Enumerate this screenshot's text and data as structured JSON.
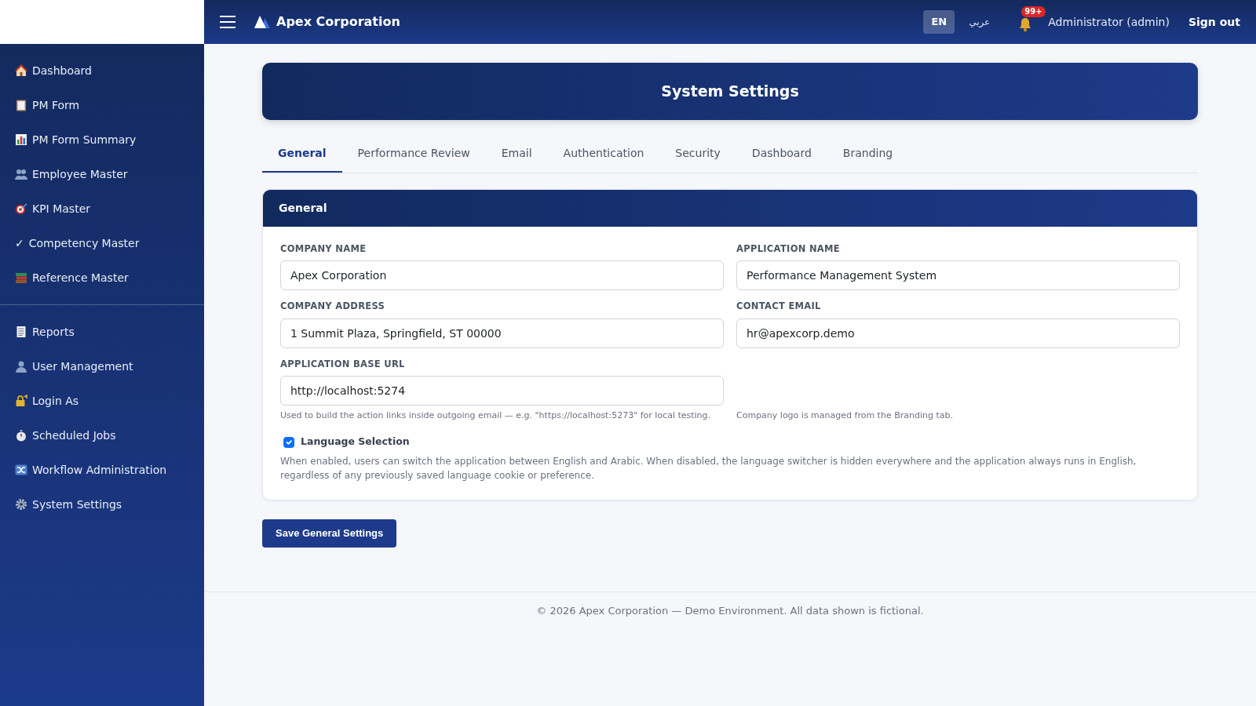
{
  "topbar": {
    "brand": "Apex Corporation",
    "languages": [
      {
        "label": "EN",
        "selected": true
      },
      {
        "label": "عربي",
        "selected": false
      }
    ],
    "notification_count": "99+",
    "user": "Administrator (admin)",
    "sign_out": "Sign out"
  },
  "sidebar": {
    "sections": [
      {
        "items": [
          {
            "label": "Dashboard"
          },
          {
            "label": "PM Form"
          },
          {
            "label": "PM Form Summary"
          },
          {
            "label": "Employee Master"
          },
          {
            "label": "KPI Master"
          },
          {
            "label": "Competency Master",
            "glyph": "✓"
          },
          {
            "label": "Reference Master"
          }
        ]
      },
      {
        "items": [
          {
            "label": "Reports"
          },
          {
            "label": "User Management"
          },
          {
            "label": "Login As"
          },
          {
            "label": "Scheduled Jobs"
          },
          {
            "label": "Workflow Administration"
          },
          {
            "label": "System Settings"
          }
        ]
      }
    ]
  },
  "page_title": "System Settings",
  "tabs": [
    {
      "label": "General",
      "selected": true
    },
    {
      "label": "Performance Review",
      "selected": false
    },
    {
      "label": "Email",
      "selected": false
    },
    {
      "label": "Authentication",
      "selected": false
    },
    {
      "label": "Security",
      "selected": false
    },
    {
      "label": "Dashboard",
      "selected": false
    },
    {
      "label": "Branding",
      "selected": false
    }
  ],
  "panel": {
    "title": "General",
    "fields": [
      {
        "label": "COMPANY NAME",
        "value": "Apex Corporation"
      },
      {
        "label": "APPLICATION NAME",
        "value": "Performance Management System"
      },
      {
        "label": "COMPANY ADDRESS",
        "value": "1 Summit Plaza, Springfield, ST 00000"
      },
      {
        "label": "CONTACT EMAIL",
        "value": "hr@apexcorp.demo"
      },
      {
        "label": "APPLICATION BASE URL",
        "value": "http://localhost:5274",
        "help": "Used to build the action links inside outgoing email — e.g. \"https://localhost:5273\" for local testing."
      }
    ],
    "logo_note": "Company logo is managed from the Branding tab.",
    "language_option": {
      "label": "Language Selection",
      "checked": true,
      "description": "When enabled, users can switch the application between English and Arabic. When disabled, the language switcher is hidden everywhere and the application always runs in English, regardless of any previously saved language cookie or preference."
    }
  },
  "save_button": "Save General Settings",
  "footer": "© 2026 Apex Corporation — Demo Environment. All data shown is fictional."
}
